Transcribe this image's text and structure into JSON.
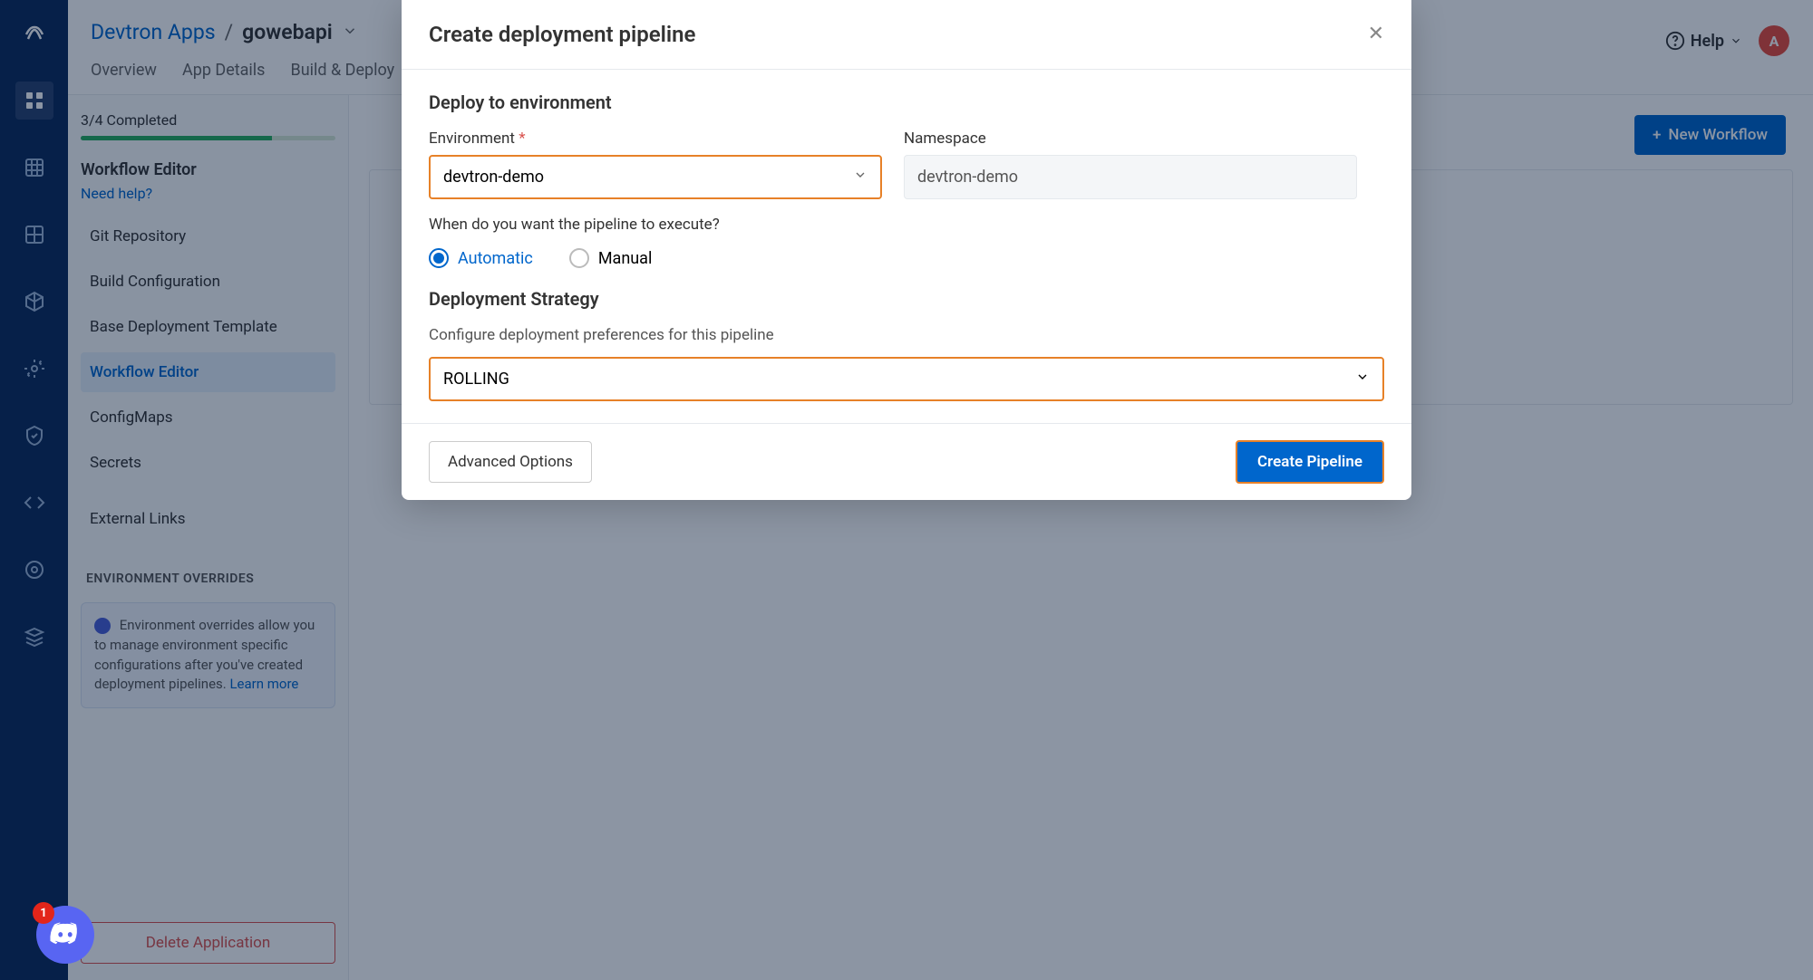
{
  "breadcrumb": {
    "root": "Devtron Apps",
    "sep": "/",
    "leaf": "gowebapi"
  },
  "tabs": [
    "Overview",
    "App Details",
    "Build & Deploy"
  ],
  "header": {
    "help": "Help",
    "avatar_initial": "A"
  },
  "sidebar": {
    "progress_label": "3/4 Completed",
    "editor_title": "Workflow Editor",
    "need_help": "Need help?",
    "links": [
      "Git Repository",
      "Build Configuration",
      "Base Deployment Template",
      "Workflow Editor",
      "ConfigMaps",
      "Secrets",
      "External Links"
    ],
    "overrides_heading": "ENVIRONMENT OVERRIDES",
    "overrides_info": "Environment overrides allow you to manage environment specific configurations after you've created deployment pipelines.",
    "learn_more": "Learn more",
    "delete_label": "Delete Application"
  },
  "canvas": {
    "new_workflow": "New Workflow"
  },
  "modal": {
    "title": "Create deployment pipeline",
    "deploy_section": "Deploy to environment",
    "env_label": "Environment",
    "env_value": "devtron-demo",
    "ns_label": "Namespace",
    "ns_value": "devtron-demo",
    "exec_question": "When do you want the pipeline to execute?",
    "radio_auto": "Automatic",
    "radio_manual": "Manual",
    "strategy_title": "Deployment Strategy",
    "strategy_desc": "Configure deployment preferences for this pipeline",
    "strategy_value": "ROLLING",
    "advanced": "Advanced Options",
    "create": "Create Pipeline"
  },
  "chat_badge": "1"
}
